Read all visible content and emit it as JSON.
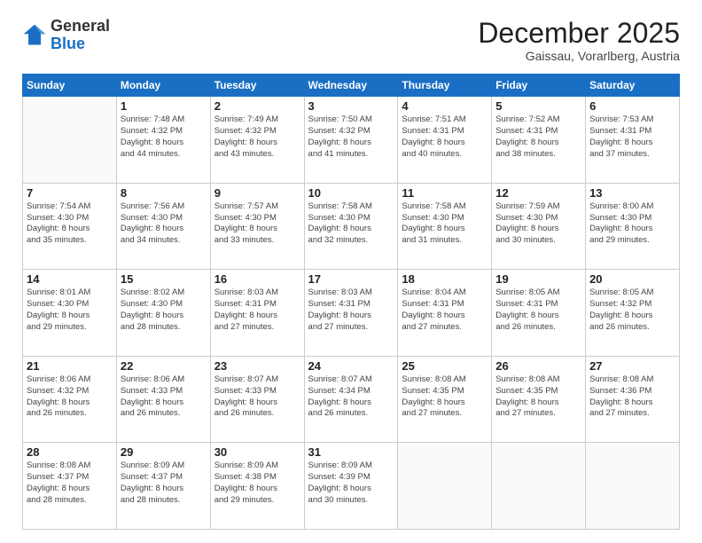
{
  "header": {
    "logo_general": "General",
    "logo_blue": "Blue",
    "month_title": "December 2025",
    "subtitle": "Gaissau, Vorarlberg, Austria"
  },
  "days_of_week": [
    "Sunday",
    "Monday",
    "Tuesday",
    "Wednesday",
    "Thursday",
    "Friday",
    "Saturday"
  ],
  "weeks": [
    [
      {
        "day": "",
        "info": ""
      },
      {
        "day": "1",
        "info": "Sunrise: 7:48 AM\nSunset: 4:32 PM\nDaylight: 8 hours\nand 44 minutes."
      },
      {
        "day": "2",
        "info": "Sunrise: 7:49 AM\nSunset: 4:32 PM\nDaylight: 8 hours\nand 43 minutes."
      },
      {
        "day": "3",
        "info": "Sunrise: 7:50 AM\nSunset: 4:32 PM\nDaylight: 8 hours\nand 41 minutes."
      },
      {
        "day": "4",
        "info": "Sunrise: 7:51 AM\nSunset: 4:31 PM\nDaylight: 8 hours\nand 40 minutes."
      },
      {
        "day": "5",
        "info": "Sunrise: 7:52 AM\nSunset: 4:31 PM\nDaylight: 8 hours\nand 38 minutes."
      },
      {
        "day": "6",
        "info": "Sunrise: 7:53 AM\nSunset: 4:31 PM\nDaylight: 8 hours\nand 37 minutes."
      }
    ],
    [
      {
        "day": "7",
        "info": "Sunrise: 7:54 AM\nSunset: 4:30 PM\nDaylight: 8 hours\nand 35 minutes."
      },
      {
        "day": "8",
        "info": "Sunrise: 7:56 AM\nSunset: 4:30 PM\nDaylight: 8 hours\nand 34 minutes."
      },
      {
        "day": "9",
        "info": "Sunrise: 7:57 AM\nSunset: 4:30 PM\nDaylight: 8 hours\nand 33 minutes."
      },
      {
        "day": "10",
        "info": "Sunrise: 7:58 AM\nSunset: 4:30 PM\nDaylight: 8 hours\nand 32 minutes."
      },
      {
        "day": "11",
        "info": "Sunrise: 7:58 AM\nSunset: 4:30 PM\nDaylight: 8 hours\nand 31 minutes."
      },
      {
        "day": "12",
        "info": "Sunrise: 7:59 AM\nSunset: 4:30 PM\nDaylight: 8 hours\nand 30 minutes."
      },
      {
        "day": "13",
        "info": "Sunrise: 8:00 AM\nSunset: 4:30 PM\nDaylight: 8 hours\nand 29 minutes."
      }
    ],
    [
      {
        "day": "14",
        "info": "Sunrise: 8:01 AM\nSunset: 4:30 PM\nDaylight: 8 hours\nand 29 minutes."
      },
      {
        "day": "15",
        "info": "Sunrise: 8:02 AM\nSunset: 4:30 PM\nDaylight: 8 hours\nand 28 minutes."
      },
      {
        "day": "16",
        "info": "Sunrise: 8:03 AM\nSunset: 4:31 PM\nDaylight: 8 hours\nand 27 minutes."
      },
      {
        "day": "17",
        "info": "Sunrise: 8:03 AM\nSunset: 4:31 PM\nDaylight: 8 hours\nand 27 minutes."
      },
      {
        "day": "18",
        "info": "Sunrise: 8:04 AM\nSunset: 4:31 PM\nDaylight: 8 hours\nand 27 minutes."
      },
      {
        "day": "19",
        "info": "Sunrise: 8:05 AM\nSunset: 4:31 PM\nDaylight: 8 hours\nand 26 minutes."
      },
      {
        "day": "20",
        "info": "Sunrise: 8:05 AM\nSunset: 4:32 PM\nDaylight: 8 hours\nand 26 minutes."
      }
    ],
    [
      {
        "day": "21",
        "info": "Sunrise: 8:06 AM\nSunset: 4:32 PM\nDaylight: 8 hours\nand 26 minutes."
      },
      {
        "day": "22",
        "info": "Sunrise: 8:06 AM\nSunset: 4:33 PM\nDaylight: 8 hours\nand 26 minutes."
      },
      {
        "day": "23",
        "info": "Sunrise: 8:07 AM\nSunset: 4:33 PM\nDaylight: 8 hours\nand 26 minutes."
      },
      {
        "day": "24",
        "info": "Sunrise: 8:07 AM\nSunset: 4:34 PM\nDaylight: 8 hours\nand 26 minutes."
      },
      {
        "day": "25",
        "info": "Sunrise: 8:08 AM\nSunset: 4:35 PM\nDaylight: 8 hours\nand 27 minutes."
      },
      {
        "day": "26",
        "info": "Sunrise: 8:08 AM\nSunset: 4:35 PM\nDaylight: 8 hours\nand 27 minutes."
      },
      {
        "day": "27",
        "info": "Sunrise: 8:08 AM\nSunset: 4:36 PM\nDaylight: 8 hours\nand 27 minutes."
      }
    ],
    [
      {
        "day": "28",
        "info": "Sunrise: 8:08 AM\nSunset: 4:37 PM\nDaylight: 8 hours\nand 28 minutes."
      },
      {
        "day": "29",
        "info": "Sunrise: 8:09 AM\nSunset: 4:37 PM\nDaylight: 8 hours\nand 28 minutes."
      },
      {
        "day": "30",
        "info": "Sunrise: 8:09 AM\nSunset: 4:38 PM\nDaylight: 8 hours\nand 29 minutes."
      },
      {
        "day": "31",
        "info": "Sunrise: 8:09 AM\nSunset: 4:39 PM\nDaylight: 8 hours\nand 30 minutes."
      },
      {
        "day": "",
        "info": ""
      },
      {
        "day": "",
        "info": ""
      },
      {
        "day": "",
        "info": ""
      }
    ]
  ]
}
